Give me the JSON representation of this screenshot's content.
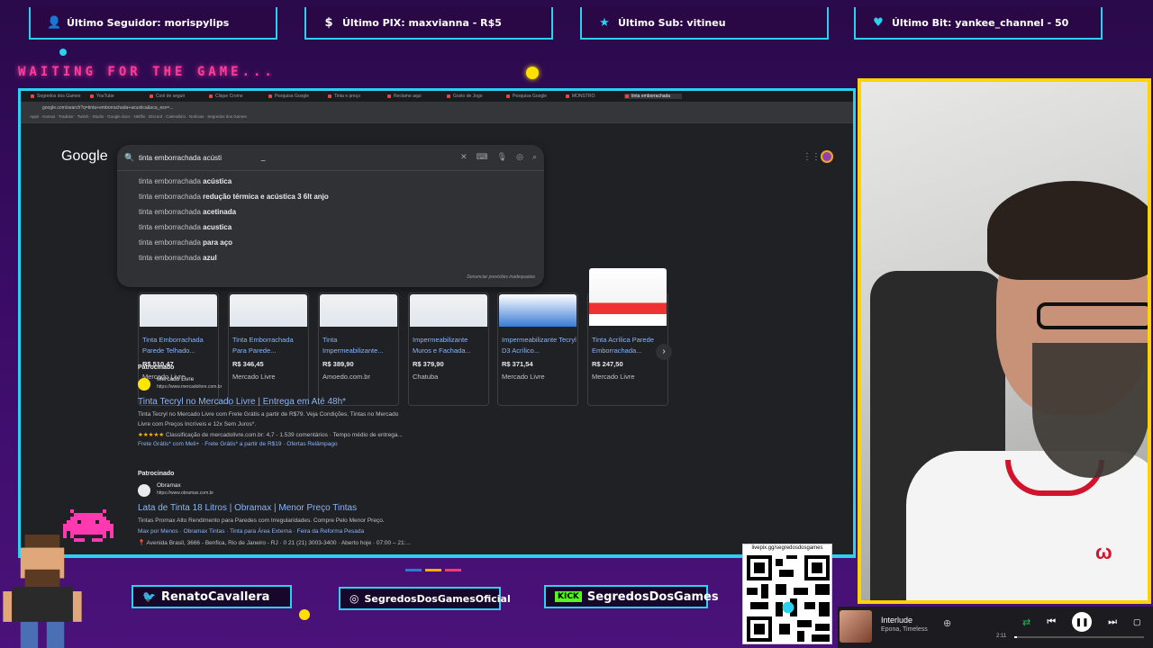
{
  "alerts": {
    "follower": "Último Seguidor: morispylips",
    "pix": "Último PIX: maxvianna - R$5",
    "sub": "Último Sub: vitineu",
    "bit": "Último Bit: yankee_channel - 50"
  },
  "waiting_text": "WAITING FOR THE GAME...",
  "browser": {
    "url": "google.com/search?q=tinta+emborrachada+acustica&sca_esv=...",
    "tabs": [
      "Segredos dos Games",
      "YouTube",
      "Cool de seguir",
      "Clique Cromo",
      "Pesquisa Google",
      "Tinta e preço",
      "Reclame aqui",
      "Gosto de Jogo",
      "Pesquisa Google",
      "MONSTRO",
      "tinta emborrachada"
    ],
    "bookmarks": "Apps · Kansai · Tradutor · Twitch · Studio · Google docs · Netflix · Discord · Calendário · Notícias · Segredos dos Games"
  },
  "google": {
    "logo": "Google",
    "query": "tinta emborrachada acústi",
    "suggestions": [
      {
        "base": "tinta emborrachada ",
        "bold": "acústica"
      },
      {
        "base": "tinta emborrachada ",
        "bold": "redução térmica e acústica 3 6lt anjo"
      },
      {
        "base": "tinta emborrachada ",
        "bold": "acetinada"
      },
      {
        "base": "tinta emborrachada ",
        "bold": "acustica"
      },
      {
        "base": "tinta emborrachada ",
        "bold": "para aço"
      },
      {
        "base": "tinta emborrachada ",
        "bold": "azul"
      }
    ],
    "report_text": "Denunciar previsões inadequadas",
    "products": [
      {
        "name": "Tinta Emborrachada Parede Telhado...",
        "price": "R$ 510,47",
        "store": "Mercado Livre"
      },
      {
        "name": "Tinta Emborrachada Para Parede...",
        "price": "R$ 346,45",
        "store": "Mercado Livre"
      },
      {
        "name": "Tinta Impermeabilizante...",
        "price": "R$ 389,90",
        "store": "Amoedo.com.br"
      },
      {
        "name": "Impermeabilizante Muros e Fachada...",
        "price": "R$ 379,90",
        "store": "Chatuba"
      },
      {
        "name": "Impermeabilizante Tecryl D3 Acrílico...",
        "price": "R$ 371,54",
        "store": "Mercado Livre"
      },
      {
        "name": "Tinta Acrílica Parede Emborrachada...",
        "price": "R$ 247,50",
        "store": "Mercado Livre"
      }
    ],
    "ads": [
      {
        "label": "Patrocinado",
        "site": "Mercado Livre",
        "url": "https://www.mercadolivre.com.br",
        "title": "Tinta Tecryl no Mercado Livre | Entrega em Até 48h*",
        "desc1": "Tinta Tecryl no Mercado Livre com Frete Grátis a partir de R$79. Veja Condições. Tintas no Mercado",
        "desc2": "Livre com Preços Incríveis e 12x Sem Juros*.",
        "rating": "★★★★★",
        "rating_text": "Classificação de mercadolivre.com.br: 4,7 - 1.539 comentários · Tempo médio de entrega...",
        "links": "Frete Grátis* com Meli+ · Frete Grátis* a partir de R$19 · Ofertas Relâmpago"
      },
      {
        "label": "Patrocinado",
        "site": "Obramax",
        "url": "https://www.obramax.com.br",
        "title": "Lata de Tinta 18 Litros | Obramax | Menor Preço Tintas",
        "desc1": "Tintas Promax Alto Rendimento para Paredes com Irregularidades. Compre Pelo Menor Preço.",
        "links": "Max por Menos · Obramax Tintas · Tinta para Área Externa · Feira da Reforma Pesada",
        "address": "📍 Avenida Brasil, 3666 - Benfica, Rio de Janeiro - RJ · 0 21 (21) 3003-3400 · Aberto hoje · 07:00 – 21:..."
      }
    ]
  },
  "socials": {
    "twitter": "RenatoCavallera",
    "instagram": "SegredosDosGamesOficial",
    "kick_badge": "KICK",
    "kick": "SegredosDosGames"
  },
  "qr": {
    "url": "livepix.gg/segredosdosgames"
  },
  "music": {
    "title": "Interlude",
    "artist": "Epona, Timeless",
    "time": "2:11",
    "progress": 0.02
  },
  "colors": {
    "accent": "#2bd2f0",
    "cam_border": "#ffd400",
    "link": "#8ab4f8",
    "neon_pink": "#ff3a9a"
  }
}
